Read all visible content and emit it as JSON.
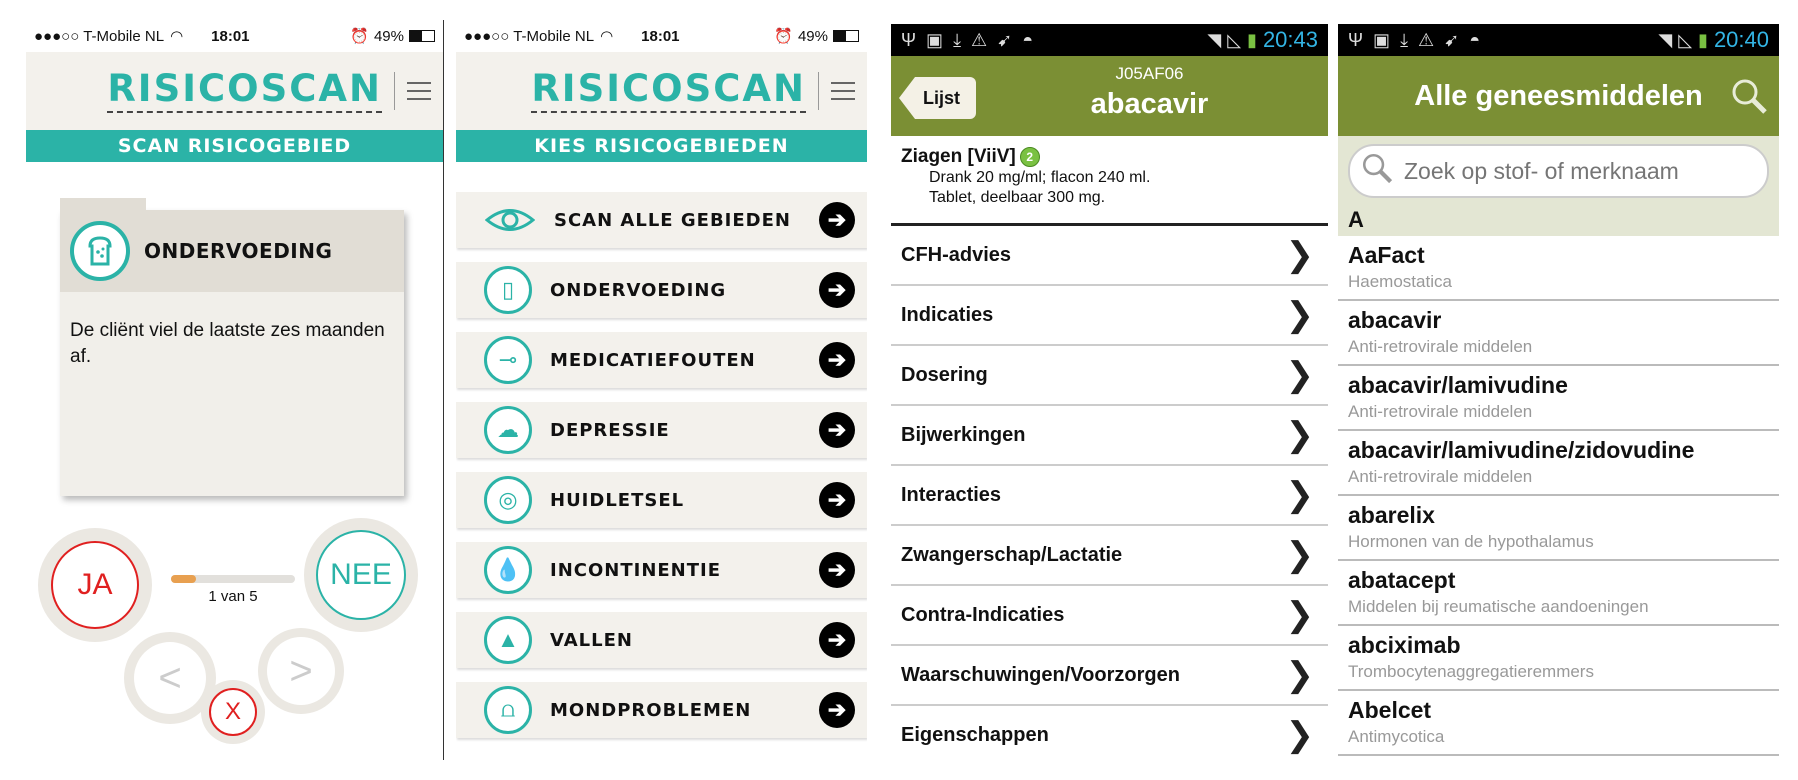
{
  "screen1": {
    "status": {
      "carrier": "●●●○○ T-Mobile NL",
      "time": "18:01",
      "battery": "49%"
    },
    "logo": "RISICOSCAN",
    "banner": "SCAN RISICOGEBIED",
    "card_title": "ONDERVOEDING",
    "card_text": "De cliënt viel de laatste zes maanden af.",
    "yes_label": "JA",
    "no_label": "NEE",
    "progress_text": "1 van 5",
    "progress_fraction": 0.2,
    "prev_label": "<",
    "next_label": ">",
    "close_label": "X"
  },
  "screen2": {
    "status": {
      "carrier": "●●●○○ T-Mobile NL",
      "time": "18:01",
      "battery": "49%"
    },
    "logo": "RISICOSCAN",
    "banner": "KIES RISICOGEBIEDEN",
    "items": [
      {
        "label": "SCAN ALLE GEBIEDEN",
        "icon": "eye-icon"
      },
      {
        "label": "ONDERVOEDING",
        "icon": "bread-icon"
      },
      {
        "label": "MEDICATIEFOUTEN",
        "icon": "pills-icon"
      },
      {
        "label": "DEPRESSIE",
        "icon": "cloud-icon"
      },
      {
        "label": "HUIDLETSEL",
        "icon": "target-icon"
      },
      {
        "label": "INCONTINENTIE",
        "icon": "drop-icon"
      },
      {
        "label": "VALLEN",
        "icon": "bell-icon"
      },
      {
        "label": "MONDPROBLEMEN",
        "icon": "tooth-icon"
      }
    ]
  },
  "screen3": {
    "status": {
      "time": "20:43"
    },
    "back_label": "Lijst",
    "code": "J05AF06",
    "name": "abacavir",
    "brand": "Ziagen [ViiV]",
    "badge": "2",
    "lines": [
      "Drank  20 mg/ml; flacon 240 ml.",
      "Tablet, deelbaar 300 mg."
    ],
    "menu": [
      "CFH-advies",
      "Indicaties",
      "Dosering",
      "Bijwerkingen",
      "Interacties",
      "Zwangerschap/Lactatie",
      "Contra-Indicaties",
      "Waarschuwingen/Voorzorgen",
      "Eigenschappen"
    ]
  },
  "screen4": {
    "status": {
      "time": "20:40"
    },
    "title": "Alle geneesmiddelen",
    "search_placeholder": "Zoek op stof- of merknaam",
    "section": "A",
    "drugs": [
      {
        "name": "AaFact",
        "category": "Haemostatica"
      },
      {
        "name": "abacavir",
        "category": "Anti-retrovirale middelen"
      },
      {
        "name": "abacavir/lamivudine",
        "category": "Anti-retrovirale middelen"
      },
      {
        "name": "abacavir/lamivudine/zidovudine",
        "category": "Anti-retrovirale middelen"
      },
      {
        "name": "abarelix",
        "category": "Hormonen van de hypothalamus"
      },
      {
        "name": "abatacept",
        "category": "Middelen bij reumatische aandoeningen"
      },
      {
        "name": "abciximab",
        "category": "Trombocytenaggregatieremmers"
      },
      {
        "name": "Abelcet",
        "category": "Antimycotica"
      }
    ]
  },
  "colors": {
    "teal": "#2bb3a7",
    "olive": "#7b8f34",
    "red": "#e02020",
    "android_clock": "#33b5e5"
  }
}
